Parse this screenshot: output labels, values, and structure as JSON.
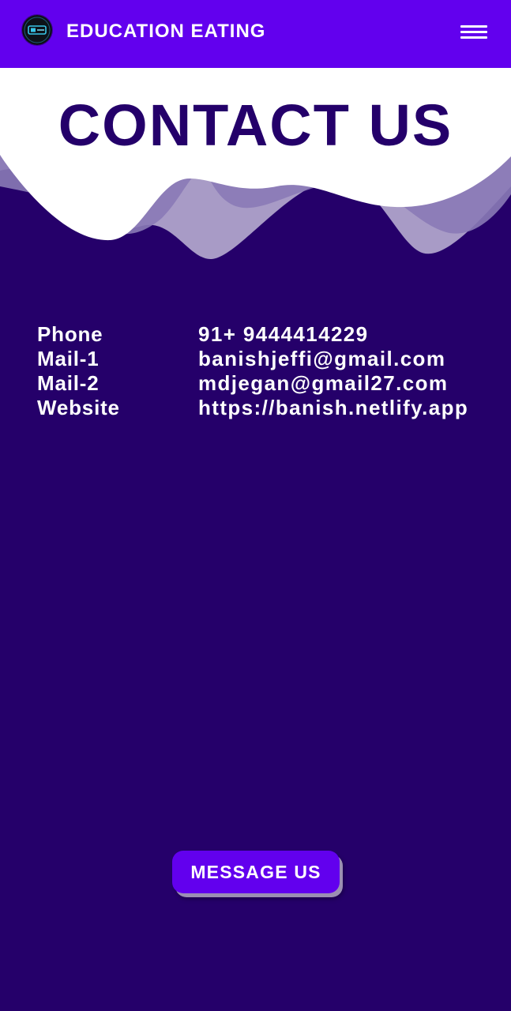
{
  "navbar": {
    "brand": "EDUCATION EATING",
    "logo_icon": "education-logo-icon",
    "menu_icon": "hamburger-menu-icon"
  },
  "hero": {
    "title": "CONTACT US"
  },
  "contacts": [
    {
      "label": "Phone",
      "value": "91+ 9444414229"
    },
    {
      "label": "Mail-1",
      "value": "banishjeffi@gmail.com"
    },
    {
      "label": "Mail-2",
      "value": "mdjegan@gmail27.com"
    },
    {
      "label": "Website",
      "value": "https://banish.netlify.app"
    }
  ],
  "cta": {
    "label": "MESSAGE US"
  },
  "colors": {
    "navbar": "#6200ee",
    "background": "#25006a",
    "title": "#24006a",
    "text": "#ffffff",
    "wave_light": "#a89bc6",
    "wave_mid": "#8a7ab6"
  }
}
